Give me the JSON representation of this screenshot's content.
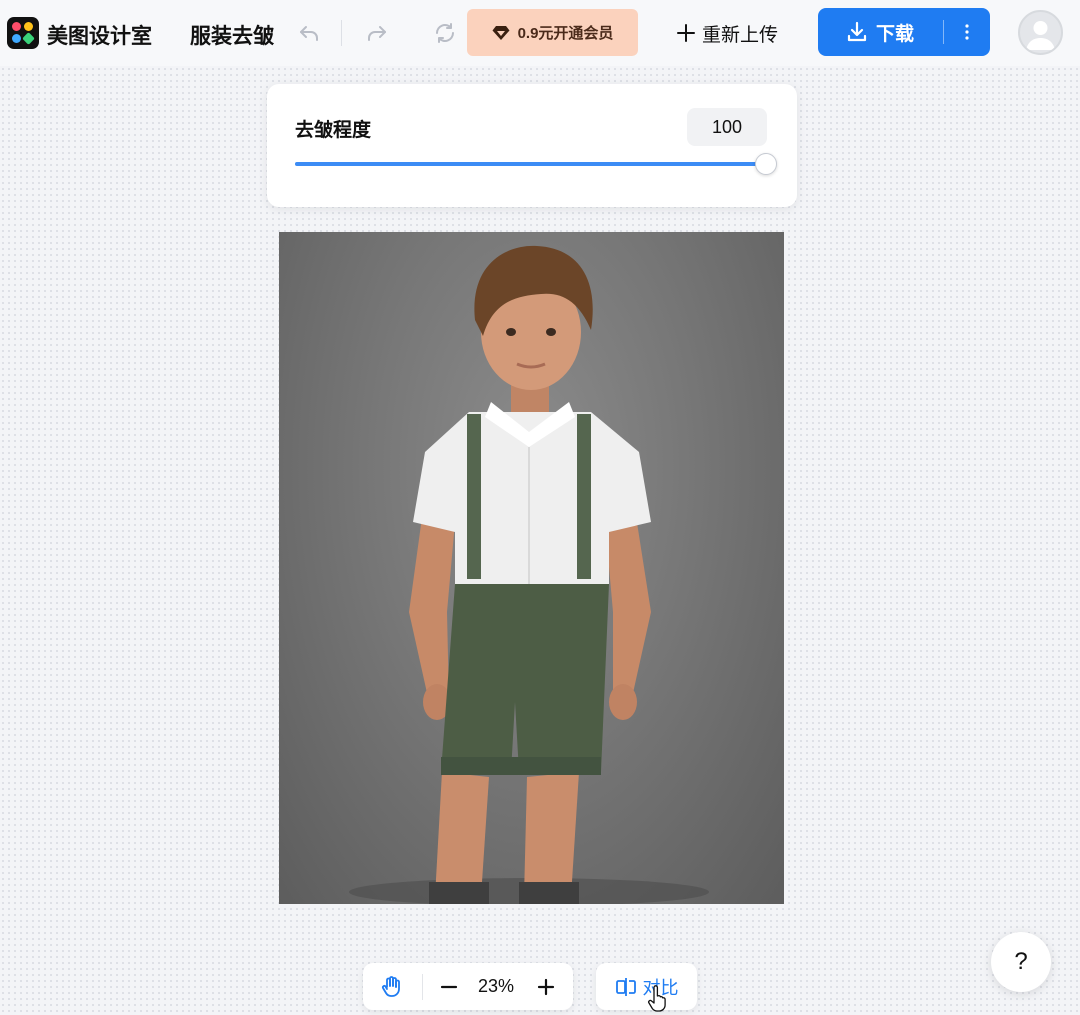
{
  "header": {
    "brand": "美图设计室",
    "tool_title": "服装去皱",
    "vip_label": "0.9元开通会员",
    "reupload_label": "重新上传",
    "download_label": "下载"
  },
  "adjust_panel": {
    "label": "去皱程度",
    "value": "100",
    "slider_fraction": 1.0
  },
  "canvas": {
    "image_alt": "boy in white shirt, green suspender shorts"
  },
  "zoom": {
    "percent": "23%"
  },
  "compare": {
    "label": "对比"
  },
  "help": {
    "label": "?"
  },
  "colors": {
    "accent": "#1f7cf2",
    "vip_bg": "#fbd2bd",
    "slider_fill": "#3c8cf5"
  },
  "icons": [
    "app-logo-icon",
    "undo-icon",
    "redo-icon",
    "refresh-icon",
    "diamond-icon",
    "plus-icon",
    "download-icon",
    "more-vertical-icon",
    "user-avatar-icon",
    "hand-icon",
    "minus-icon",
    "zoom-in-icon",
    "compare-icon",
    "pointer-cursor-icon"
  ]
}
